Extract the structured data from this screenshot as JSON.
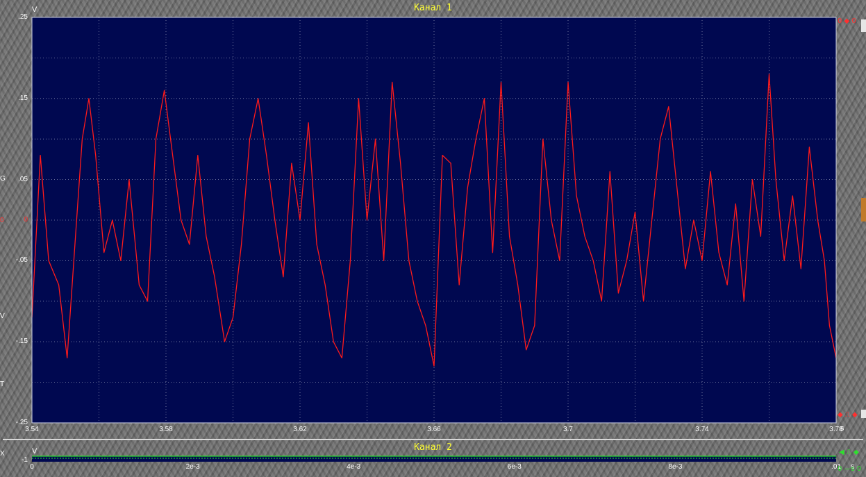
{
  "colors": {
    "trace": "#ff1a1a",
    "plot_bg": "#000850",
    "grid": "#8a8fb0",
    "title": "#ffff33",
    "ch2_trace": "#2ee02e"
  },
  "chart_data": [
    {
      "type": "line",
      "title": "Канал 1",
      "ylabel": "V",
      "xlabel": "s",
      "xlim": [
        3.54,
        3.78
      ],
      "ylim": [
        -0.25,
        0.25
      ],
      "x_ticks": [
        "3.54",
        "3.58",
        "3.62",
        "3.66",
        "3.7",
        "3.74",
        "3.78"
      ],
      "x_tick_values": [
        3.54,
        3.58,
        3.62,
        3.66,
        3.7,
        3.74,
        3.78
      ],
      "y_ticks": [
        ".25",
        ".15",
        ".05",
        "0",
        "-.05",
        "-.15",
        "-.25"
      ],
      "y_tick_values": [
        0.25,
        0.15,
        0.05,
        0,
        -0.05,
        -0.15,
        -0.25
      ],
      "grid": true,
      "series": [
        {
          "color": "#ff1a1a",
          "x": [
            3.54,
            3.5425,
            3.545,
            3.548,
            3.5505,
            3.553,
            3.555,
            3.557,
            3.559,
            3.5615,
            3.564,
            3.5665,
            3.569,
            3.572,
            3.5745,
            3.577,
            3.5795,
            3.582,
            3.5845,
            3.587,
            3.5895,
            3.592,
            3.5945,
            3.5975,
            3.6,
            3.6025,
            3.605,
            3.6075,
            3.61,
            3.6125,
            3.615,
            3.6175,
            3.62,
            3.6225,
            3.625,
            3.6275,
            3.63,
            3.6325,
            3.635,
            3.6375,
            3.64,
            3.6425,
            3.645,
            3.6475,
            3.65,
            3.6525,
            3.655,
            3.6575,
            3.66,
            3.6625,
            3.665,
            3.6675,
            3.67,
            3.6725,
            3.675,
            3.6775,
            3.68,
            3.6825,
            3.685,
            3.6875,
            3.69,
            3.6925,
            3.695,
            3.6975,
            3.7,
            3.7025,
            3.705,
            3.7075,
            3.71,
            3.7125,
            3.715,
            3.7175,
            3.72,
            3.7225,
            3.725,
            3.7275,
            3.73,
            3.7325,
            3.735,
            3.7375,
            3.74,
            3.7425,
            3.745,
            3.7475,
            3.75,
            3.7525,
            3.755,
            3.7575,
            3.76,
            3.762,
            3.7645,
            3.767,
            3.7695,
            3.772,
            3.7745,
            3.7765,
            3.778,
            3.78
          ],
          "y": [
            -0.12,
            0.08,
            -0.05,
            -0.08,
            -0.17,
            -0.02,
            0.1,
            0.15,
            0.08,
            -0.04,
            0.0,
            -0.05,
            0.05,
            -0.08,
            -0.1,
            0.1,
            0.16,
            0.08,
            0.0,
            -0.03,
            0.08,
            -0.02,
            -0.07,
            -0.15,
            -0.12,
            -0.03,
            0.1,
            0.15,
            0.08,
            0.0,
            -0.07,
            0.07,
            0.0,
            0.12,
            -0.03,
            -0.08,
            -0.15,
            -0.17,
            -0.05,
            0.15,
            0.0,
            0.1,
            -0.05,
            0.17,
            0.07,
            -0.05,
            -0.1,
            -0.13,
            -0.18,
            0.08,
            0.07,
            -0.08,
            0.04,
            0.1,
            0.15,
            -0.04,
            0.17,
            -0.02,
            -0.08,
            -0.16,
            -0.13,
            0.1,
            0.0,
            -0.05,
            0.17,
            0.03,
            -0.02,
            -0.05,
            -0.1,
            0.06,
            -0.09,
            -0.05,
            0.01,
            -0.1,
            0.0,
            0.1,
            0.14,
            0.04,
            -0.06,
            0.0,
            -0.05,
            0.06,
            -0.04,
            -0.08,
            0.02,
            -0.1,
            0.05,
            -0.02,
            0.18,
            0.05,
            -0.05,
            0.03,
            -0.06,
            0.09,
            0.0,
            -0.05,
            -0.13,
            -0.17
          ]
        }
      ]
    },
    {
      "type": "line",
      "title": "Канал 2",
      "ylabel": "V",
      "xlabel": "s",
      "xlim": [
        0,
        0.01
      ],
      "x_ticks": [
        "0",
        "2e-3",
        "4e-3",
        "6e-3",
        "8e-3",
        ".01"
      ],
      "x_tick_values": [
        0,
        0.002,
        0.004,
        0.006,
        0.008,
        0.01
      ],
      "y_ticks": [
        "-1"
      ],
      "grid": true
    }
  ],
  "edge_markers": {
    "ch1_top_right": "0 ◆ 0",
    "ch1_bottom_right": "◆ ⎍ ◆",
    "ch2_top_right": "◀ ⎍ ◆",
    "ch2_bottom_right": "0 —s 0",
    "left_edge": [
      "G",
      "0",
      "V",
      "T",
      "X"
    ]
  }
}
